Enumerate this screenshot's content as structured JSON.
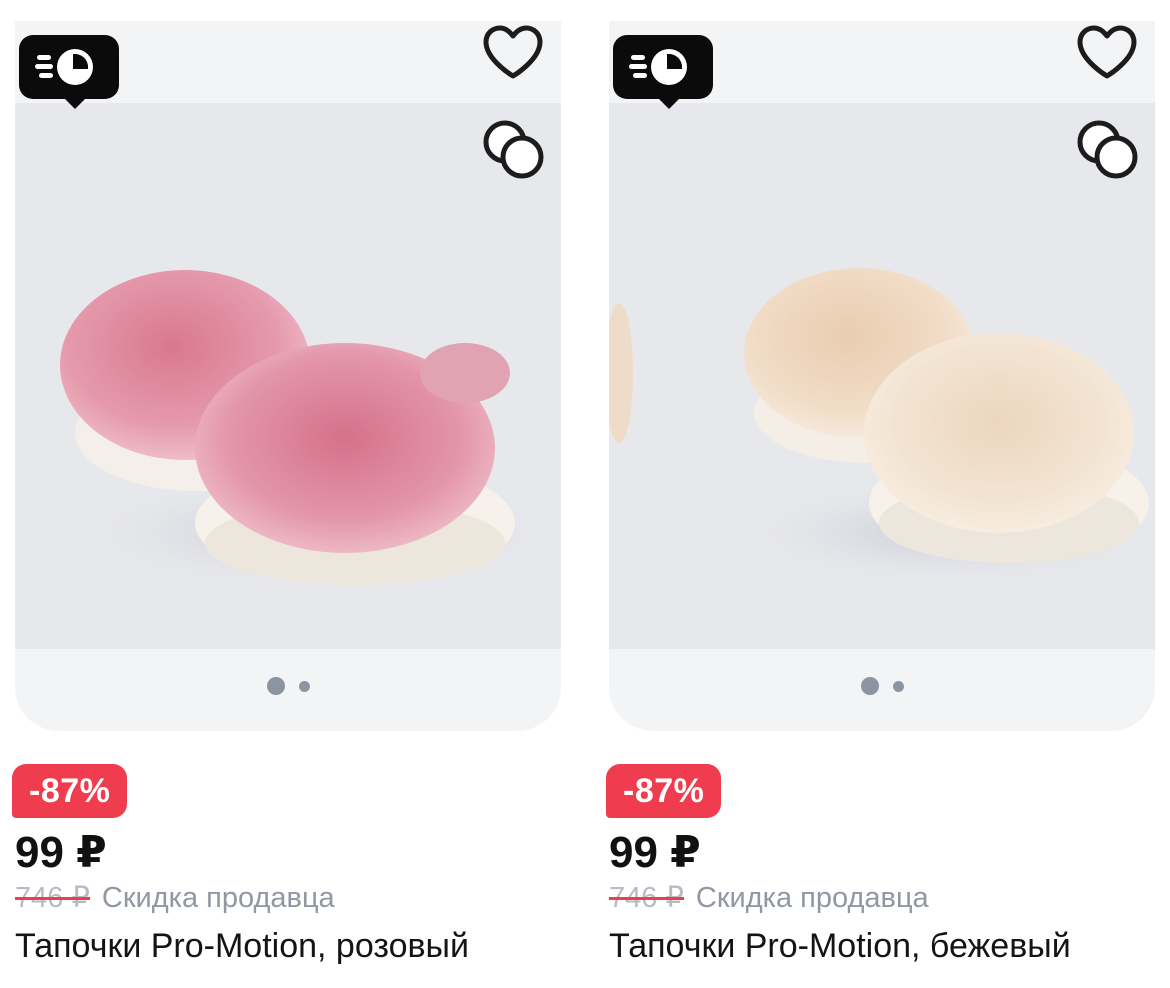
{
  "colors": {
    "accent_red": "#ef3d4f",
    "badge_black": "#0b0b0b",
    "card_bg": "#f3f4f6"
  },
  "products": [
    {
      "express_icon": "express-delivery-icon",
      "discount_badge": "-87%",
      "price": "99 ₽",
      "old_price": "746 ₽",
      "discount_label": "Скидка продавца",
      "title": "Тапочки Pro-Motion, розовый",
      "image_alt": "pink fur slippers",
      "slides": {
        "count": 2,
        "active": 1
      }
    },
    {
      "express_icon": "express-delivery-icon",
      "discount_badge": "-87%",
      "price": "99 ₽",
      "old_price": "746 ₽",
      "discount_label": "Скидка продавца",
      "title": "Тапочки Pro-Motion, бежевый",
      "image_alt": "beige fur slippers",
      "slides": {
        "count": 2,
        "active": 1
      }
    }
  ]
}
